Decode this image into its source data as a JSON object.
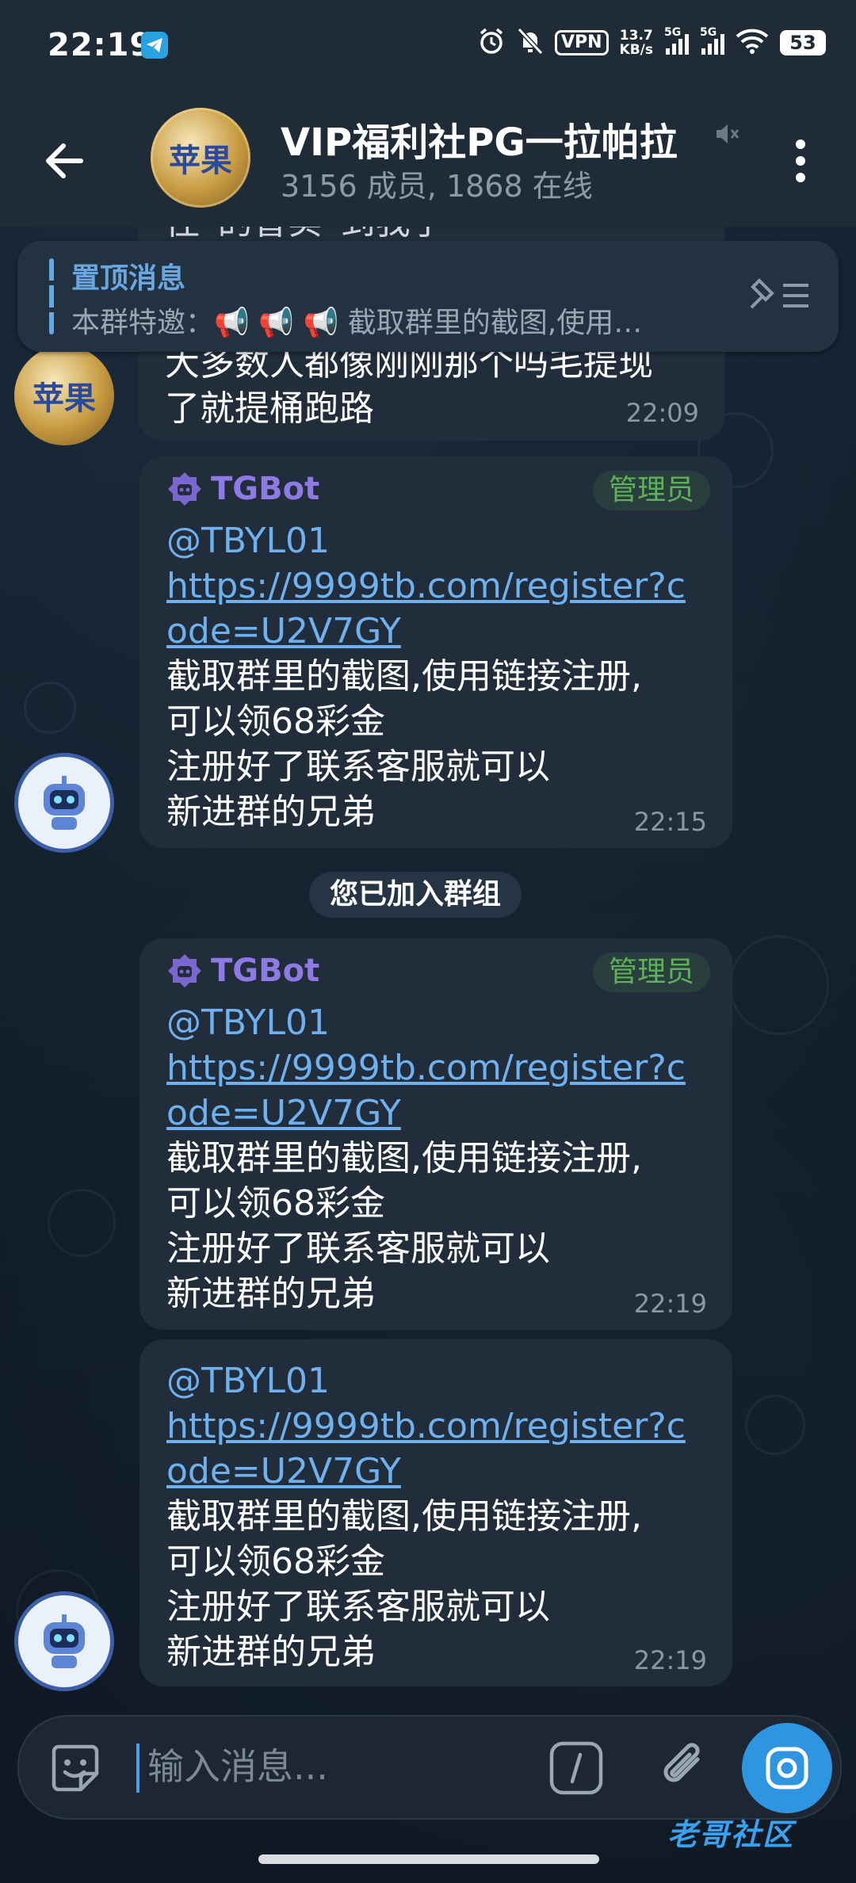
{
  "status_bar": {
    "time": "22:19",
    "vpn": "VPN",
    "net_speed_value": "13.7",
    "net_speed_unit": "KB/s",
    "signal1_label": "5G",
    "signal2_label": "5G",
    "battery": "53"
  },
  "header": {
    "title": "VIP福利社PG一拉帕拉",
    "subtitle": "3156 成员, 1868 在线",
    "avatar_text": "苹果"
  },
  "pinned": {
    "title": "置顶消息",
    "text": "本群特邀：📢 📢 📢  截取群里的截图,使用…"
  },
  "messages": [
    {
      "partial_line_top": "往“的香实”到我了",
      "line1": "大多数人都像刚刚那个吗毛提现",
      "line2": "了就提桶跑路",
      "time": "22:09"
    },
    {
      "sender": "TGBot",
      "badge": "管理员",
      "mention": "@TBYL01",
      "link_line1": "https://9999tb.com/register?c",
      "link_line2": "ode=U2V7GY",
      "line3": "截取群里的截图,使用链接注册,",
      "line4": "可以领68彩金",
      "line5": "注册好了联系客服就可以",
      "line6": "新进群的兄弟",
      "time": "22:15"
    },
    {
      "sender": "TGBot",
      "badge": "管理员",
      "mention": "@TBYL01",
      "link_line1": "https://9999tb.com/register?c",
      "link_line2": "ode=U2V7GY",
      "line3": "截取群里的截图,使用链接注册,",
      "line4": "可以领68彩金",
      "line5": "注册好了联系客服就可以",
      "line6": "新进群的兄弟",
      "time": "22:19"
    },
    {
      "mention": "@TBYL01",
      "link_line1": "https://9999tb.com/register?c",
      "link_line2": "ode=U2V7GY",
      "line3": "截取群里的截图,使用链接注册,",
      "line4": "可以领68彩金",
      "line5": "注册好了联系客服就可以",
      "line6": "新进群的兄弟",
      "time": "22:19"
    }
  ],
  "service_message": "您已加入群组",
  "composer": {
    "placeholder": "输入消息..."
  },
  "watermark": "老哥社区",
  "colors": {
    "header_bg": "#1f2b36",
    "bubble_bg": "#212d3b",
    "link": "#6fb1ee",
    "sender": "#8d7ae3",
    "admin": "#5db157",
    "camera": "#2f95e0"
  }
}
